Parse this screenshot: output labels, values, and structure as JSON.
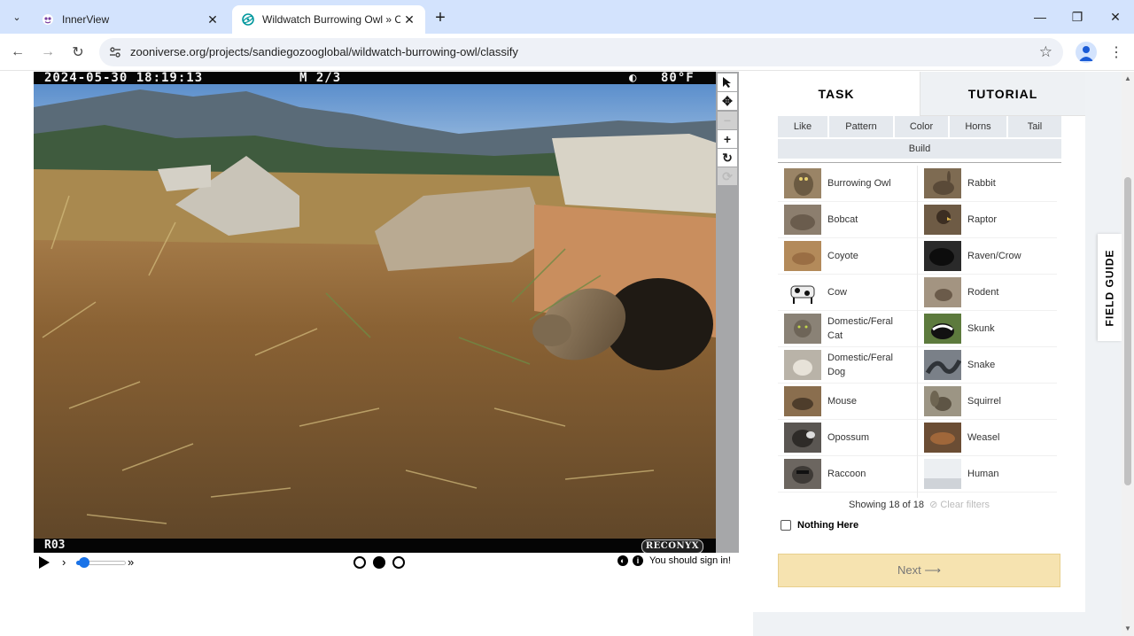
{
  "browser": {
    "tabs": [
      {
        "title": "InnerView",
        "active": false
      },
      {
        "title": "Wildwatch Burrowing Owl » Cla",
        "active": true
      }
    ],
    "url": "zooniverse.org/projects/sandiegozooglobal/wildwatch-burrowing-owl/classify"
  },
  "camera": {
    "timestamp": "2024-05-30  18:19:13",
    "mode": "M 2/3",
    "temperature": "80°F",
    "station": "R03",
    "brand": "RECONYX"
  },
  "controls": {
    "sign_in_text": "You should sign in!",
    "current_frame": 2,
    "frame_count": 3
  },
  "task_panel": {
    "tabs": {
      "task": "TASK",
      "tutorial": "TUTORIAL"
    },
    "filters": [
      "Like",
      "Pattern",
      "Color",
      "Horns",
      "Tail",
      "Build"
    ],
    "choices": [
      {
        "label": "Burrowing Owl"
      },
      {
        "label": "Rabbit"
      },
      {
        "label": "Bobcat"
      },
      {
        "label": "Raptor"
      },
      {
        "label": "Coyote"
      },
      {
        "label": "Raven/Crow"
      },
      {
        "label": "Cow"
      },
      {
        "label": "Rodent"
      },
      {
        "label": "Domestic/Feral Cat"
      },
      {
        "label": "Skunk"
      },
      {
        "label": "Domestic/Feral Dog"
      },
      {
        "label": "Snake"
      },
      {
        "label": "Mouse"
      },
      {
        "label": "Squirrel"
      },
      {
        "label": "Opossum"
      },
      {
        "label": "Weasel"
      },
      {
        "label": "Raccoon"
      },
      {
        "label": "Human"
      }
    ],
    "showing": "Showing 18 of 18",
    "clear_filters": "Clear filters",
    "nothing_here": "Nothing Here",
    "next": "Next ⟶"
  },
  "field_guide": "FIELD GUIDE"
}
